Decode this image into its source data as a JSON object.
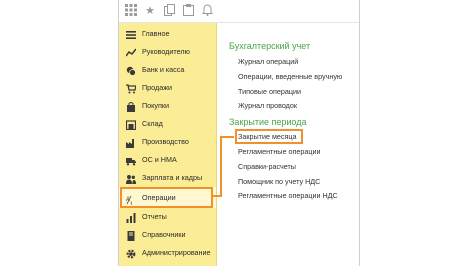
{
  "toolbar": {
    "icons": [
      "grid-icon",
      "star-icon",
      "copy-icon",
      "clipboard-icon",
      "bell-icon"
    ]
  },
  "sidebar": {
    "items": [
      {
        "label": "Главное",
        "icon": "menu-icon"
      },
      {
        "label": "Руководителю",
        "icon": "chart-line-icon"
      },
      {
        "label": "Банк и касса",
        "icon": "bank-icon"
      },
      {
        "label": "Продажи",
        "icon": "cart-icon"
      },
      {
        "label": "Покупки",
        "icon": "bag-icon"
      },
      {
        "label": "Склад",
        "icon": "warehouse-icon"
      },
      {
        "label": "Производство",
        "icon": "factory-icon"
      },
      {
        "label": "ОС и НМА",
        "icon": "truck-icon"
      },
      {
        "label": "Зарплата и кадры",
        "icon": "people-icon"
      },
      {
        "label": "Операции",
        "icon": "operations-icon"
      },
      {
        "label": "Отчеты",
        "icon": "report-icon"
      },
      {
        "label": "Справочники",
        "icon": "book-icon"
      },
      {
        "label": "Администрирование",
        "icon": "gear-icon"
      }
    ],
    "active_index": 9
  },
  "content": {
    "sections": [
      {
        "title": "Бухгалтерский учет",
        "links": [
          "Журнал операций",
          "Операции, введенные вручную",
          "Типовые операции",
          "Журнал проводок"
        ]
      },
      {
        "title": "Закрытие периода",
        "links": [
          "Закрытие месяца",
          "Регламентные операции",
          "Справки-расчеты",
          "Помощник по учету НДС",
          "Регламентные операции НДС"
        ]
      }
    ],
    "highlighted_link": "Закрытие месяца"
  },
  "colors": {
    "sidebar_bg": "#fbec96",
    "accent_orange": "#f1912d",
    "section_green": "#4aa34a"
  }
}
